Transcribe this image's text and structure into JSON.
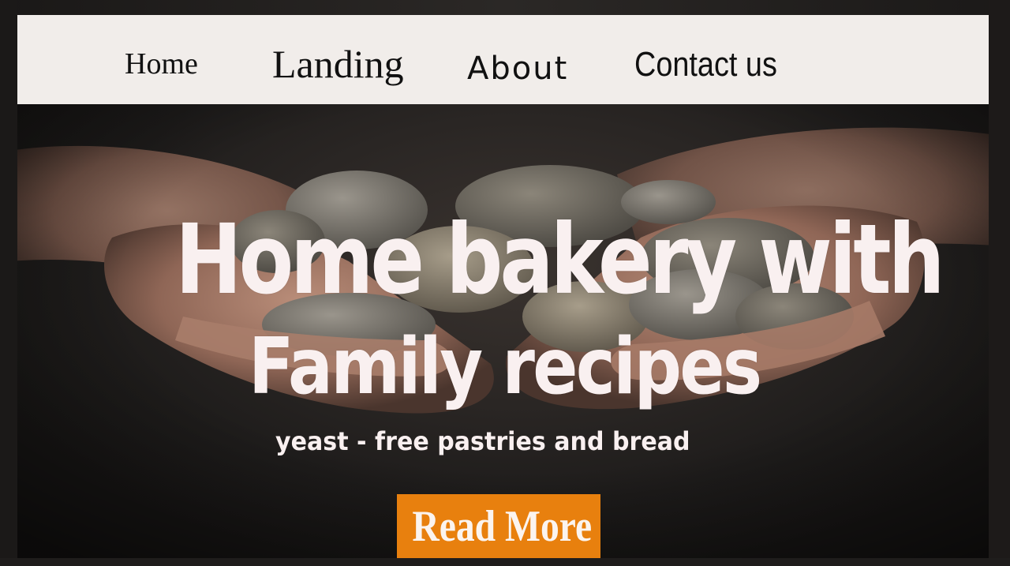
{
  "navbar": {
    "items": [
      {
        "label": "Home"
      },
      {
        "label": "Landing"
      },
      {
        "label": "About"
      },
      {
        "label": "Contact us"
      }
    ]
  },
  "hero": {
    "headline_line1": "Home bakery with",
    "headline_line2": "Family recipes",
    "subtitle": "yeast - free pastries and bread",
    "cta_label": "Read More",
    "image_subject": "hands holding stones",
    "colors": {
      "navbar_bg": "#f1edea",
      "headline": "#f9f0f0",
      "cta_bg": "#e8800e",
      "cta_text": "#fbf4ef"
    }
  }
}
